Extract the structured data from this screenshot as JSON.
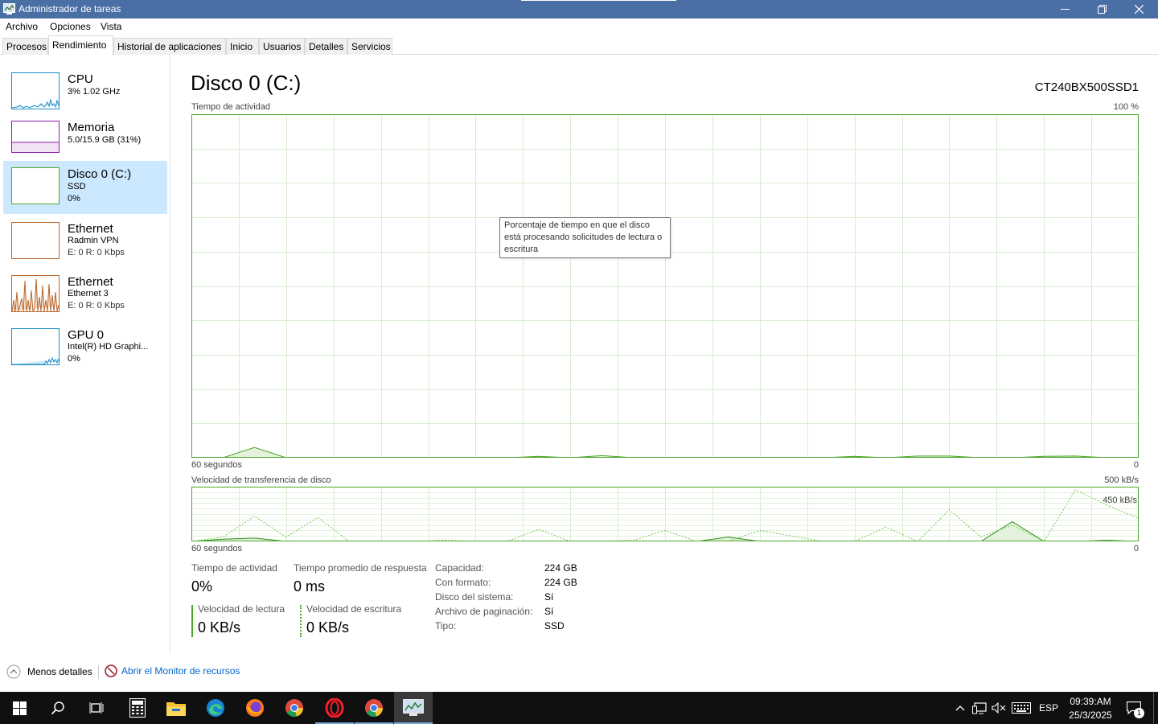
{
  "window": {
    "title": "Administrador de tareas"
  },
  "menu": [
    "Archivo",
    "Opciones",
    "Vista"
  ],
  "tabs": [
    "Procesos",
    "Rendimiento",
    "Historial de aplicaciones",
    "Inicio",
    "Usuarios",
    "Detalles",
    "Servicios"
  ],
  "active_tab": "Rendimiento",
  "sidebar": {
    "items": [
      {
        "title": "CPU",
        "line1": "3% 1.02 GHz",
        "line2": "",
        "color": "#1a8cc8",
        "selected": false
      },
      {
        "title": "Memoria",
        "line1": "5.0/15.9 GB (31%)",
        "line2": "",
        "color": "#8b1fa8",
        "selected": false,
        "fill": 0.31
      },
      {
        "title": "Disco 0 (C:)",
        "line1": "SSD",
        "line2": "0%",
        "color": "#4aa629",
        "selected": true
      },
      {
        "title": "Ethernet",
        "line1": "Radmin VPN",
        "line2": "E: 0 R: 0 Kbps",
        "color": "#b8652a",
        "selected": false
      },
      {
        "title": "Ethernet",
        "line1": "Ethernet 3",
        "line2": "E: 0 R: 0 Kbps",
        "color": "#b8652a",
        "selected": false
      },
      {
        "title": "GPU 0",
        "line1": "Intel(R) HD Graphi...",
        "line2": "0%",
        "color": "#1a8cc8",
        "selected": false
      }
    ]
  },
  "main": {
    "title": "Disco 0 (C:)",
    "model": "CT240BX500SSD1",
    "activity_label": "Tiempo de actividad",
    "activity_max": "100 %",
    "time_label_1": "60 segundos",
    "zero_1": "0",
    "transfer_label": "Velocidad de transferencia de disco",
    "transfer_max": "500 kB/s",
    "transfer_inner": "450 kB/s",
    "time_label_2": "60 segundos",
    "zero_2": "0",
    "tooltip": "Porcentaje de tiempo en que el disco está procesando solicitudes de lectura o escritura"
  },
  "stats": {
    "activity_label": "Tiempo de actividad",
    "activity_value": "0%",
    "response_label": "Tiempo promedio de respuesta",
    "response_value": "0 ms",
    "read_label": "Velocidad de lectura",
    "read_value": "0 KB/s",
    "write_label": "Velocidad de escritura",
    "write_value": "0 KB/s"
  },
  "properties": [
    {
      "label": "Capacidad:",
      "value": "224 GB"
    },
    {
      "label": "Con formato:",
      "value": "224 GB"
    },
    {
      "label": "Disco del sistema:",
      "value": "Sí"
    },
    {
      "label": "Archivo de paginación:",
      "value": "Sí"
    },
    {
      "label": "Tipo:",
      "value": "SSD"
    }
  ],
  "footer": {
    "less_details": "Menos detalles",
    "resource_monitor": "Abrir el Monitor de recursos"
  },
  "taskbar": {
    "language": "ESP",
    "time": "09:39:AM",
    "date": "25/3/2025",
    "notifications": "1"
  },
  "chart_data": [
    {
      "type": "area",
      "title": "Tiempo de actividad",
      "ylim": [
        0,
        100
      ],
      "unit": "%",
      "x": [
        60,
        58,
        56,
        54,
        52,
        50,
        48,
        46,
        44,
        42,
        40,
        38,
        36,
        34,
        32,
        30,
        28,
        26,
        24,
        22,
        20,
        18,
        16,
        14,
        12,
        10,
        8,
        6,
        4,
        2,
        0
      ],
      "series": [
        {
          "values": [
            0,
            0,
            3,
            0,
            0,
            0,
            0,
            0,
            0,
            0,
            0,
            0.4,
            0,
            0.6,
            0,
            0,
            0,
            0,
            0,
            0,
            0,
            0.4,
            0,
            0.5,
            0.5,
            0,
            0,
            0.4,
            0.5,
            0,
            0
          ]
        }
      ]
    },
    {
      "type": "line",
      "title": "Velocidad de transferencia de disco",
      "ylim": [
        0,
        500
      ],
      "unit": "kB/s",
      "x": [
        60,
        58,
        56,
        54,
        52,
        50,
        48,
        46,
        44,
        42,
        40,
        38,
        36,
        34,
        32,
        30,
        28,
        26,
        24,
        22,
        20,
        18,
        16,
        14,
        12,
        10,
        8,
        6,
        4,
        2,
        0
      ],
      "series": [
        {
          "values": [
            0,
            20,
            30,
            0,
            0,
            0,
            0,
            0,
            0,
            0,
            0,
            0,
            0,
            0,
            0,
            0,
            0,
            40,
            0,
            0,
            0,
            0,
            0,
            0,
            0,
            0,
            180,
            0,
            0,
            10,
            0
          ]
        },
        {
          "values": [
            0,
            40,
            230,
            40,
            220,
            0,
            0,
            0,
            10,
            0,
            0,
            110,
            0,
            0,
            10,
            100,
            0,
            0,
            100,
            50,
            0,
            0,
            130,
            0,
            290,
            40,
            150,
            0,
            470,
            330,
            210
          ]
        }
      ]
    }
  ]
}
